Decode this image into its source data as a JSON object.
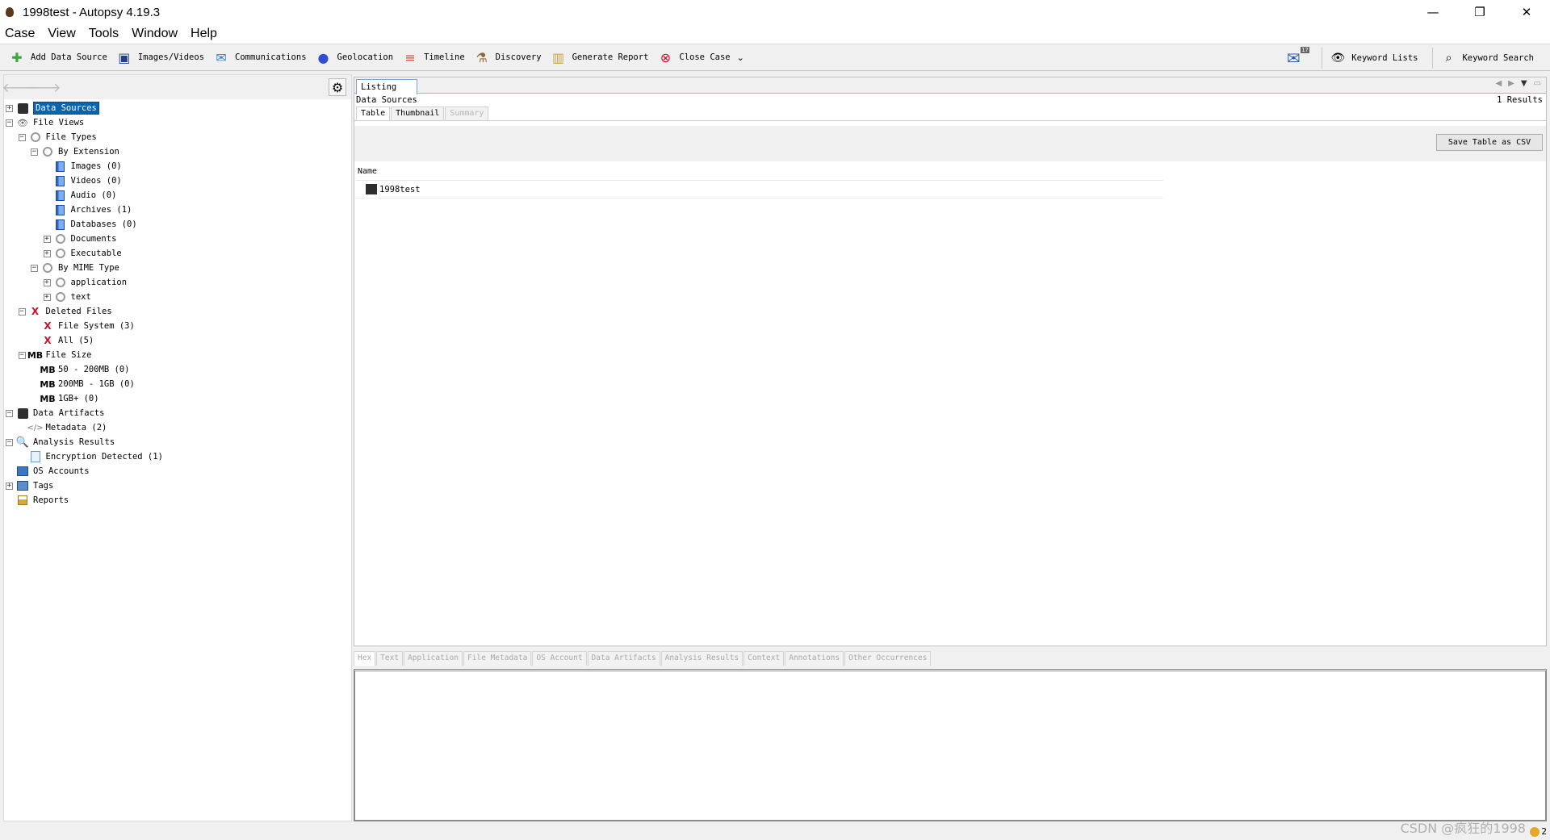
{
  "window": {
    "title": "1998test - Autopsy 4.19.3",
    "minimize": "—",
    "restore": "❐",
    "close": "✕"
  },
  "menu": [
    "Case",
    "View",
    "Tools",
    "Window",
    "Help"
  ],
  "toolbar": {
    "buttons": [
      {
        "label": "Add Data Source",
        "icon": "add-icon",
        "glyph": "✚",
        "color": "#3aa63a"
      },
      {
        "label": "Images/Videos",
        "icon": "images-videos-icon",
        "glyph": "▣",
        "color": "#1f3f8f"
      },
      {
        "label": "Communications",
        "icon": "communications-icon",
        "glyph": "✉",
        "color": "#2f7fd0"
      },
      {
        "label": "Geolocation",
        "icon": "geolocation-icon",
        "glyph": "●",
        "color": "#2f4fd0"
      },
      {
        "label": "Timeline",
        "icon": "timeline-icon",
        "glyph": "≡",
        "color": "#e0402a"
      },
      {
        "label": "Discovery",
        "icon": "discovery-icon",
        "glyph": "⚗",
        "color": "#8a6a3a"
      },
      {
        "label": "Generate Report",
        "icon": "report-icon",
        "glyph": "▥",
        "color": "#c9a23a"
      },
      {
        "label": "Close Case",
        "icon": "close-case-icon",
        "glyph": "⊗",
        "color": "#d0102a"
      }
    ],
    "close_case_dropdown": "⌄",
    "mail_count": "17",
    "keyword_lists": "Keyword Lists",
    "keyword_search": "Keyword Search"
  },
  "left": {
    "back": "🡐",
    "forward": "🡒",
    "settings": "⚙",
    "tree": [
      {
        "level": 0,
        "toggle": "+",
        "icon": "db",
        "label": "Data Sources",
        "selected": true,
        "name": "tree-data-sources"
      },
      {
        "level": 0,
        "toggle": "−",
        "icon": "eye",
        "label": "File Views",
        "name": "tree-file-views"
      },
      {
        "level": 1,
        "toggle": "−",
        "icon": "gear",
        "label": "File Types",
        "name": "tree-file-types"
      },
      {
        "level": 2,
        "toggle": "−",
        "icon": "gear",
        "label": "By Extension",
        "name": "tree-by-extension"
      },
      {
        "level": 3,
        "toggle": "",
        "icon": "folder",
        "label": "Images  (0)",
        "name": "tree-images"
      },
      {
        "level": 3,
        "toggle": "",
        "icon": "folder",
        "label": "Videos  (0)",
        "name": "tree-videos"
      },
      {
        "level": 3,
        "toggle": "",
        "icon": "folder",
        "label": "Audio  (0)",
        "name": "tree-audio"
      },
      {
        "level": 3,
        "toggle": "",
        "icon": "folder",
        "label": "Archives  (1)",
        "name": "tree-archives"
      },
      {
        "level": 3,
        "toggle": "",
        "icon": "folder",
        "label": "Databases  (0)",
        "name": "tree-databases"
      },
      {
        "level": 3,
        "toggle": "+",
        "icon": "gear",
        "label": "Documents",
        "name": "tree-documents"
      },
      {
        "level": 3,
        "toggle": "+",
        "icon": "gear",
        "label": "Executable",
        "name": "tree-executable"
      },
      {
        "level": 2,
        "toggle": "−",
        "icon": "gear",
        "label": "By MIME Type",
        "name": "tree-by-mime-type"
      },
      {
        "level": 3,
        "toggle": "+",
        "icon": "gear",
        "label": "application",
        "name": "tree-application"
      },
      {
        "level": 3,
        "toggle": "+",
        "icon": "gear",
        "label": "text",
        "name": "tree-text"
      },
      {
        "level": 1,
        "toggle": "−",
        "icon": "x",
        "label": "Deleted Files",
        "name": "tree-deleted-files"
      },
      {
        "level": 2,
        "toggle": "",
        "icon": "x",
        "label": "File System  (3)",
        "name": "tree-file-system"
      },
      {
        "level": 2,
        "toggle": "",
        "icon": "x",
        "label": "All  (5)",
        "name": "tree-all"
      },
      {
        "level": 1,
        "toggle": "−",
        "icon": "mb",
        "label": "File Size",
        "name": "tree-file-size"
      },
      {
        "level": 2,
        "toggle": "",
        "icon": "mb",
        "label": "50 - 200MB  (0)",
        "name": "tree-size-50-200"
      },
      {
        "level": 2,
        "toggle": "",
        "icon": "mb",
        "label": "200MB - 1GB  (0)",
        "name": "tree-size-200-1g"
      },
      {
        "level": 2,
        "toggle": "",
        "icon": "mb",
        "label": "1GB+  (0)",
        "name": "tree-size-1g"
      },
      {
        "level": 0,
        "toggle": "−",
        "icon": "artifacts",
        "label": "Data Artifacts",
        "name": "tree-data-artifacts"
      },
      {
        "level": 1,
        "toggle": "",
        "icon": "code",
        "label": "Metadata  (2)",
        "name": "tree-metadata"
      },
      {
        "level": 0,
        "toggle": "−",
        "icon": "search",
        "label": "Analysis Results",
        "name": "tree-analysis-results"
      },
      {
        "level": 1,
        "toggle": "",
        "icon": "doc",
        "label": "Encryption Detected  (1)",
        "name": "tree-encryption-detected"
      },
      {
        "level": 0,
        "toggle": "",
        "icon": "accounts",
        "label": "OS Accounts",
        "name": "tree-os-accounts"
      },
      {
        "level": 0,
        "toggle": "+",
        "icon": "tags",
        "label": "Tags",
        "name": "tree-tags"
      },
      {
        "level": 0,
        "toggle": "",
        "icon": "report",
        "label": "Reports",
        "name": "tree-reports"
      }
    ]
  },
  "listing": {
    "tab": "Listing",
    "header": "Data Sources",
    "results": "1 Results",
    "view_tabs": [
      {
        "label": "Table",
        "state": "active"
      },
      {
        "label": "Thumbnail",
        "state": "normal"
      },
      {
        "label": "Summary",
        "state": "disabled"
      }
    ],
    "save_csv": "Save Table as CSV",
    "columns": [
      "Name"
    ],
    "rows": [
      [
        "1998test"
      ]
    ]
  },
  "content_tabs": [
    "Hex",
    "Text",
    "Application",
    "File Metadata",
    "OS Account",
    "Data Artifacts",
    "Analysis Results",
    "Context",
    "Annotations",
    "Other Occurrences"
  ],
  "status": {
    "notification_count": "2",
    "watermark": "CSDN @疯狂的1998"
  }
}
